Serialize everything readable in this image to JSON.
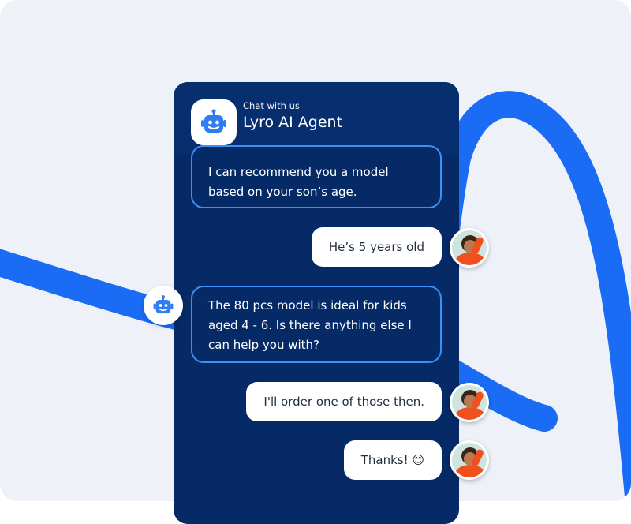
{
  "colors": {
    "background": "#eef2f8",
    "ribbon": "#1a6cf5",
    "chat_panel": "#052a66",
    "bot_bubble_border": "#3b8ff5",
    "user_bubble": "#ffffff"
  },
  "header": {
    "subtitle": "Chat with us",
    "title": "Lyro AI Agent",
    "avatar_icon": "robot-icon"
  },
  "messages": [
    {
      "sender": "bot",
      "text": "I can recommend you a model based on your son’s age."
    },
    {
      "sender": "user",
      "text": "He’s 5 years old"
    },
    {
      "sender": "bot",
      "text": "The 80 pcs model is ideal for kids aged 4 - 6. Is there anything else I can help you with?"
    },
    {
      "sender": "user",
      "text": "I'll order one of those then."
    },
    {
      "sender": "user",
      "text": "Thanks! 😊"
    }
  ]
}
